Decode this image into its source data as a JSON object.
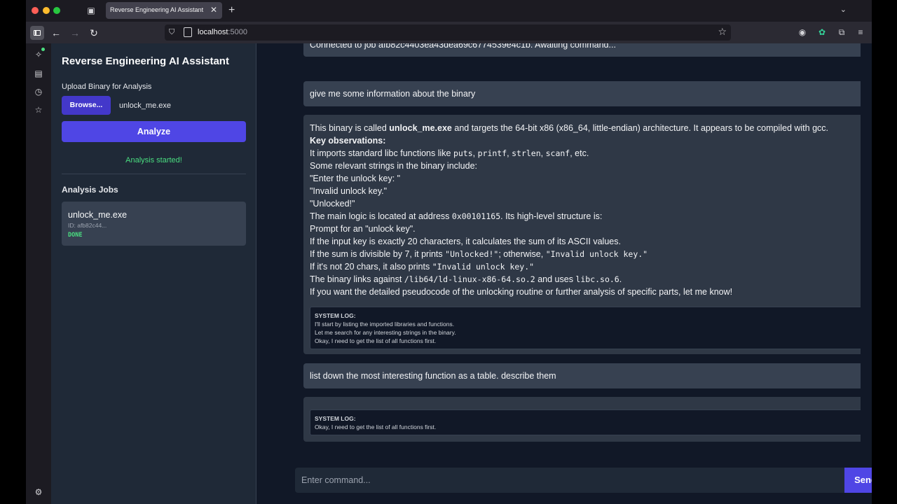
{
  "browser": {
    "tab_title": "Reverse Engineering AI Assistant",
    "url_host": "localhost",
    "url_port": ":5000"
  },
  "sidebar": {
    "app_title": "Reverse Engineering AI Assistant",
    "upload_label": "Upload Binary for Analysis",
    "browse_label": "Browse...",
    "file_name": "unlock_me.exe",
    "analyze_label": "Analyze",
    "status_message": "Analysis started!",
    "jobs_heading": "Analysis Jobs",
    "jobs": [
      {
        "name": "unlock_me.exe",
        "id": "ID: afb82c44...",
        "status": "DONE"
      }
    ]
  },
  "chat": {
    "connected": "Connected to job afb82c4403ea43dea69c6774539e4c1b. Awaiting command...",
    "user_message_1": "give me some information about the binary",
    "answer": {
      "line1_pre": "This binary is called ",
      "line1_bold": "unlock_me.exe",
      "line1_post": " and targets the 64-bit x86 (x86_64, little-endian) architecture. It appears to be compiled with gcc.",
      "line2": "Key observations:",
      "line3_pre": "It imports standard libc functions like ",
      "line3_c1": "puts",
      "line3_c2": "printf",
      "line3_c3": "strlen",
      "line3_c4": "scanf",
      "line3_post": ", etc.",
      "line4": "Some relevant strings in the binary include:",
      "line5": "\"Enter the unlock key: \"",
      "line6": "\"Invalid unlock key.\"",
      "line7": "\"Unlocked!\"",
      "line8_pre": "The main logic is located at address ",
      "line8_code": "0x00101165",
      "line8_post": ". Its high-level structure is:",
      "line9": "Prompt for an \"unlock key\".",
      "line10": "If the input key is exactly 20 characters, it calculates the sum of its ASCII values.",
      "line11_pre": "If the sum is divisible by 7, it prints ",
      "line11_code1": "\"Unlocked!\"",
      "line11_mid": "; otherwise, ",
      "line11_code2": "\"Invalid unlock key.\"",
      "line12_pre": "If it's not 20 chars, it also prints ",
      "line12_code": "\"Invalid unlock key.\"",
      "line13_pre": "The binary links against ",
      "line13_code1": "/lib64/ld-linux-x86-64.so.2",
      "line13_mid": " and uses ",
      "line13_code2": "libc.so.6",
      "line13_post": ".",
      "line14": "If you want the detailed pseudocode of the unlocking routine or further analysis of specific parts, let me know!"
    },
    "system_log_title": "SYSTEM LOG:",
    "system_log_1": [
      "I'll start by listing the imported libraries and functions.",
      "Let me search for any interesting strings in the binary.",
      "Okay, I need to get the list of all functions first."
    ],
    "user_message_2": "list down the most interesting function as a table. describe them",
    "system_log_2": [
      "Okay, I need to get the list of all functions first."
    ]
  },
  "command": {
    "placeholder": "Enter command...",
    "send_label": "Send"
  },
  "colors": {
    "accent": "#4f46e5",
    "success": "#4ade80",
    "panel_bg": "#1f2937",
    "page_bg": "#111827"
  }
}
